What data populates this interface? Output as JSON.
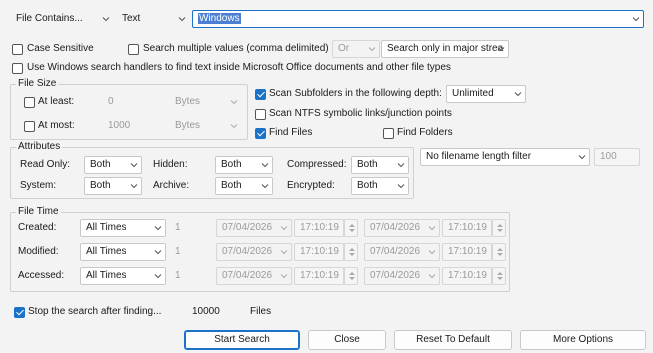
{
  "search": {
    "mode": "File Contains...",
    "type": "Text",
    "query": "Windows"
  },
  "options": {
    "case_sensitive": "Case Sensitive",
    "search_multiple": "Search multiple values (comma delimited)",
    "or_label": "Or",
    "search_scope": "Search only in major strea",
    "use_windows_handlers": "Use Windows search handlers to find text inside Microsoft Office documents and other file types"
  },
  "file_size": {
    "title": "File Size",
    "at_least_label": "At least:",
    "at_least_value": "0",
    "at_least_unit": "Bytes",
    "at_most_label": "At most:",
    "at_most_value": "1000",
    "at_most_unit": "Bytes"
  },
  "scan": {
    "subfolders_label": "Scan Subfolders in the following depth:",
    "depth_value": "Unlimited",
    "ntfs_label": "Scan NTFS symbolic links/junction points",
    "find_files_label": "Find Files",
    "find_folders_label": "Find Folders"
  },
  "attributes": {
    "title": "Attributes",
    "read_only_label": "Read Only:",
    "read_only_value": "Both",
    "hidden_label": "Hidden:",
    "hidden_value": "Both",
    "compressed_label": "Compressed:",
    "compressed_value": "Both",
    "system_label": "System:",
    "system_value": "Both",
    "archive_label": "Archive:",
    "archive_value": "Both",
    "encrypted_label": "Encrypted:",
    "encrypted_value": "Both"
  },
  "filename_filter": {
    "value": "No filename length filter",
    "number": "100"
  },
  "file_time": {
    "title": "File Time",
    "rows": [
      {
        "label": "Created:",
        "value": "All Times",
        "num": "1",
        "date1": "07/04/2026",
        "time1": "17:10:19",
        "date2": "07/04/2026",
        "time2": "17:10:19"
      },
      {
        "label": "Modified:",
        "value": "All Times",
        "num": "1",
        "date1": "07/04/2026",
        "time1": "17:10:19",
        "date2": "07/04/2026",
        "time2": "17:10:19"
      },
      {
        "label": "Accessed:",
        "value": "All Times",
        "num": "1",
        "date1": "07/04/2026",
        "time1": "17:10:19",
        "date2": "07/04/2026",
        "time2": "17:10:19"
      }
    ]
  },
  "stop": {
    "label": "Stop the search after finding...",
    "value": "10000",
    "unit": "Files"
  },
  "buttons": {
    "start": "Start Search",
    "close": "Close",
    "reset": "Reset To Default",
    "more": "More Options"
  },
  "colors": {
    "accent": "#1a73c8",
    "selection": "#4a7fd4"
  }
}
